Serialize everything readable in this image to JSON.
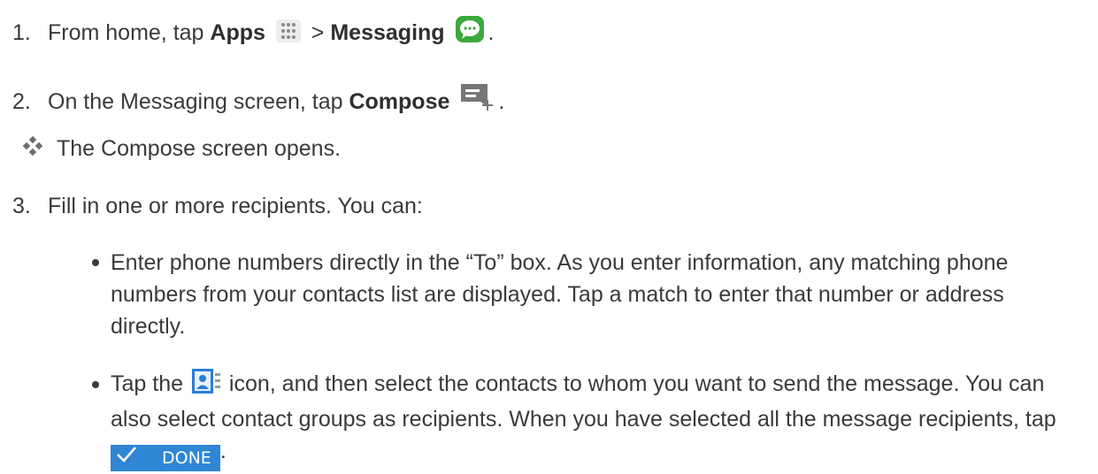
{
  "steps": [
    {
      "number": "1.",
      "prefix": "From home, tap ",
      "bold1": "Apps",
      "sep": " > ",
      "bold2": "Messaging",
      "suffix": "."
    },
    {
      "number": "2.",
      "prefix": "On the Messaging screen, tap ",
      "bold": "Compose",
      "suffix": "."
    },
    {
      "note": "The Compose screen opens."
    },
    {
      "number": "3.",
      "text": "Fill in one or more recipients. You can:"
    }
  ],
  "bullets": [
    {
      "text": "Enter phone numbers directly in the “To” box. As you enter information, any matching phone numbers from your contacts list are displayed. Tap a match to enter that number or address directly."
    },
    {
      "prefix": "Tap the",
      "middle": "icon, and then select the contacts to whom you want to send the message. You can also select contact groups as recipients. When you have selected all the message recipients, tap",
      "suffix": "."
    }
  ],
  "done_button": {
    "label": "DONE",
    "color": "#2f86d4"
  },
  "icons": [
    "apps-grid-icon",
    "messaging-app-icon",
    "compose-message-icon",
    "note-diamond-icon",
    "contacts-card-icon",
    "checkmark-icon"
  ]
}
